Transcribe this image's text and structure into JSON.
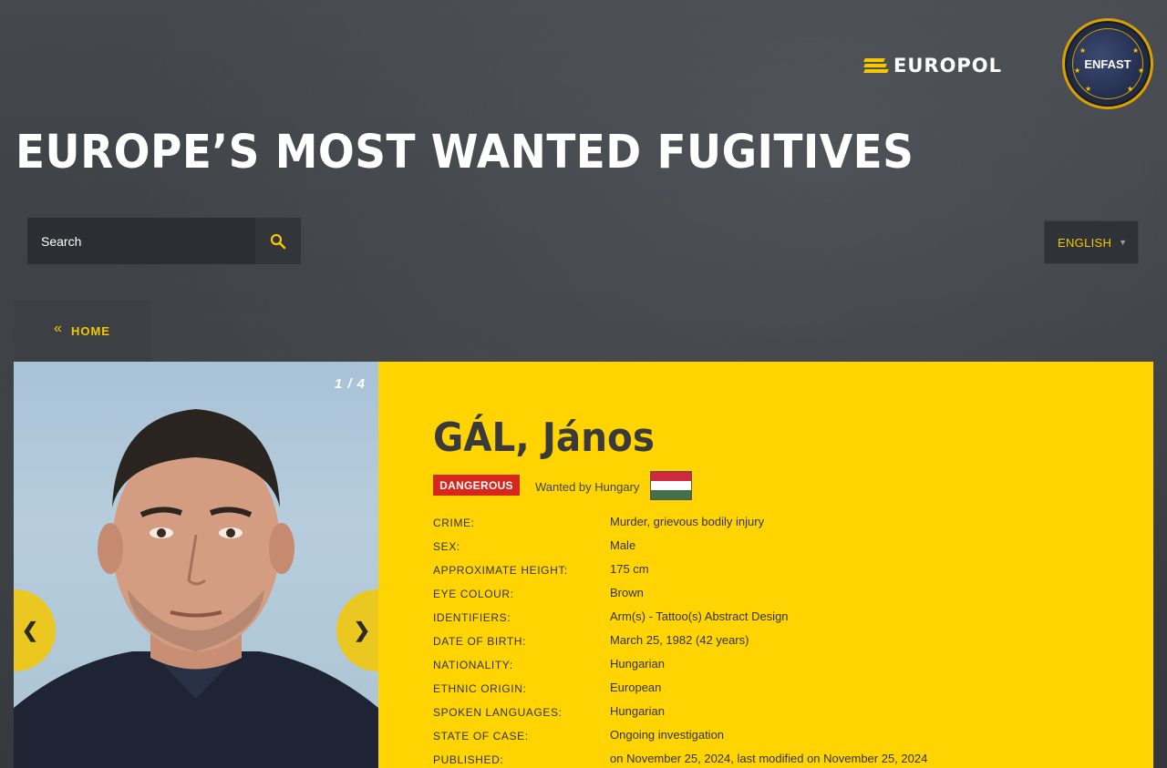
{
  "header": {
    "europol_logo_text": "EUROPOL",
    "enfast_logo_text": "ENFAST",
    "title": "EUROPE’S MOST WANTED FUGITIVES"
  },
  "search": {
    "placeholder": "Search",
    "icon": "search-icon"
  },
  "language": {
    "selected": "ENGLISH",
    "icon": "chevron-down-icon"
  },
  "nav": {
    "home_label": "HOME",
    "home_icon": "double-chevron-left-icon"
  },
  "gallery": {
    "counter": "1 / 4",
    "prev_label": "❮",
    "next_label": "❯"
  },
  "person": {
    "name": "GÁL, János",
    "badge": "DANGEROUS",
    "wanted_by": "Wanted by Hungary",
    "flag": "Hungary",
    "details": [
      {
        "label": "CRIME:",
        "value": "Murder, grievous bodily injury"
      },
      {
        "label": "SEX:",
        "value": "Male"
      },
      {
        "label": "APPROXIMATE HEIGHT:",
        "value": "175 cm"
      },
      {
        "label": "EYE COLOUR:",
        "value": "Brown"
      },
      {
        "label": "IDENTIFIERS:",
        "value": "Arm(s) - Tattoo(s) Abstract Design"
      },
      {
        "label": "DATE OF BIRTH:",
        "value": "March 25, 1982 (42 years)"
      },
      {
        "label": "NATIONALITY:",
        "value": "Hungarian"
      },
      {
        "label": "ETHNIC ORIGIN:",
        "value": "European"
      },
      {
        "label": "SPOKEN LANGUAGES:",
        "value": "Hungarian"
      },
      {
        "label": "STATE OF CASE:",
        "value": "Ongoing investigation"
      },
      {
        "label": "PUBLISHED:",
        "value": "on November 25, 2024, last modified on November 25, 2024"
      }
    ]
  },
  "colors": {
    "accent_yellow": "#ffd400",
    "danger_red": "#d8261c",
    "background": "#3a3d42"
  }
}
